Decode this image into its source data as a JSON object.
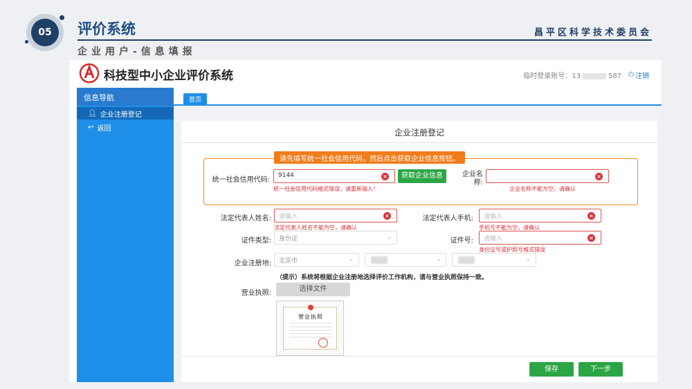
{
  "slide": {
    "number": "05",
    "title": "评价系统",
    "org": "昌平区科学技术委员会",
    "subtitle": "企业用户-信息填报"
  },
  "app": {
    "title": "科技型中小企业评价系统",
    "account_label": "临时登录账号：13",
    "account_suffix": "587",
    "logout": "注销"
  },
  "sidebar": {
    "heading": "信息导航",
    "items": [
      {
        "label": "企业注册登记",
        "icon": "user-icon",
        "active": true
      },
      {
        "label": "返回",
        "icon": "back-icon",
        "active": false
      }
    ]
  },
  "tabs": [
    {
      "label": "首页"
    }
  ],
  "form": {
    "title": "企业注册登记",
    "tip": "请先填写统一社会信用代码，然后点击获取企业信息按钮。",
    "credit_code": {
      "label": "统一社会信用代码:",
      "value": "9144",
      "error": "统一社会信用代码格式错误，请重新输入！"
    },
    "fetch_button": "获取企业信息",
    "company_name": {
      "label_line1": "企业名",
      "label_line2": "称:",
      "value": "",
      "error": "企业名称不能为空，请确认"
    },
    "legal_name": {
      "label": "法定代表人姓名:",
      "placeholder": "请输入",
      "error": "法定代表人姓名不能为空，请确认"
    },
    "legal_phone": {
      "label": "法定代表人手机:",
      "placeholder": "请输入",
      "error": "手机号不能为空，请确认"
    },
    "id_type": {
      "label": "证件类型:",
      "value": "身份证"
    },
    "id_number": {
      "label": "证件号:",
      "placeholder": "请输入",
      "error": "身份证号或护照号格式错误"
    },
    "address": {
      "label": "企业注册地:",
      "city": "北京市"
    },
    "address_note": "（提示）系统将根据企业注册地选择评价工作机构，请与营业执照保持一致。",
    "license": {
      "label": "营业执照:",
      "button": "选择文件",
      "image_title": "营业执照"
    },
    "save_button": "保存",
    "next_button": "下一步"
  },
  "colors": {
    "primary": "#1e8fe8",
    "nav_dark": "#1369b8",
    "accent_orange": "#f07c1a",
    "error_red": "#d9303a",
    "green": "#2ca544",
    "slide_navy": "#1f3f66"
  }
}
